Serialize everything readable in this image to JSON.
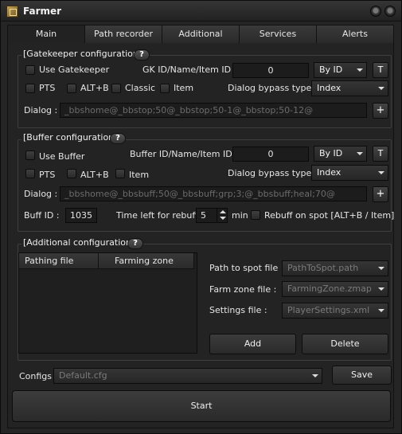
{
  "window": {
    "title": "Farmer"
  },
  "tabs": [
    "Main",
    "Path recorder",
    "Additional",
    "Services",
    "Alerts"
  ],
  "gatekeeper": {
    "title": "[Gatekeeper configurations]",
    "help": "?",
    "use_label": "Use Gatekeeper",
    "id_label": "GK ID/Name/Item ID :",
    "id_value": "0",
    "by_select": "By ID",
    "t_button": "T",
    "pts": "PTS",
    "altb": "ALT+B",
    "classic": "Classic",
    "item": "Item",
    "bypass_label": "Dialog bypass type :",
    "bypass_value": "Index",
    "dialog_label": "Dialog :",
    "dialog_value": "_bbshome@_bbstop;50@_bbstop;50-1@_bbstop;50-12@",
    "plus": "+"
  },
  "buffer": {
    "title": "[Buffer configurations]",
    "help": "?",
    "use_label": "Use Buffer",
    "id_label": "Buffer ID/Name/Item ID :",
    "id_value": "0",
    "by_select": "By ID",
    "t_button": "T",
    "pts": "PTS",
    "altb": "ALT+B",
    "item": "Item",
    "bypass_label": "Dialog bypass type :",
    "bypass_value": "Index",
    "dialog_label": "Dialog :",
    "dialog_value": "_bbshome@_bbsbuff;50@_bbsbuff;grp;3;@_bbsbuff;heal;70@",
    "plus": "+",
    "buff_id_label": "Buff ID :",
    "buff_id_value": "1035",
    "time_left_label": "Time left for rebuff",
    "time_left_value": "5",
    "min_label": "min",
    "rebuff_label": "Rebuff on spot [ALT+B / Item]"
  },
  "additional": {
    "title": "[Additional configurations]",
    "help": "?",
    "columns": [
      "Pathing file",
      "Farming zone"
    ],
    "path_label": "Path to spot file :",
    "path_value": "PathToSpot.path",
    "zone_label": "Farm zone file :",
    "zone_value": "FarmingZone.zmap",
    "settings_label": "Settings file :",
    "settings_value": "PlayerSettings.xml",
    "add_button": "Add",
    "delete_button": "Delete"
  },
  "configs": {
    "label": "Configs :",
    "value": "Default.cfg",
    "save_button": "Save"
  },
  "start_button": "Start"
}
